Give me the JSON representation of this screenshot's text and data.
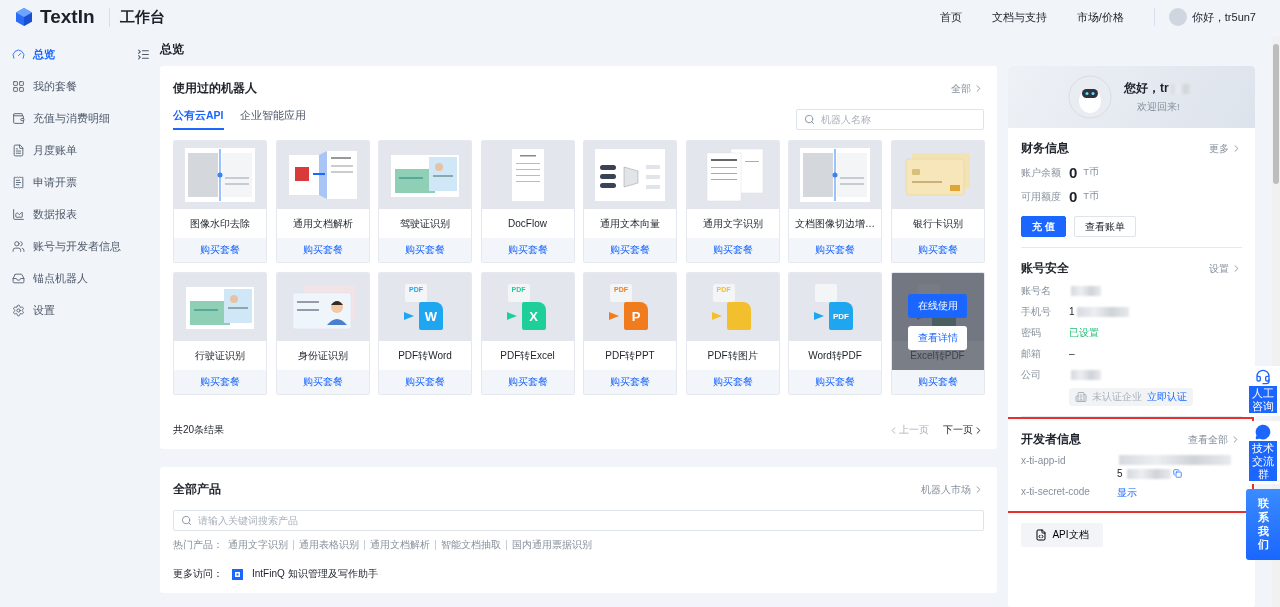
{
  "header": {
    "brand": "TextIn",
    "product": "工作台",
    "nav": [
      "首页",
      "文档与支持",
      "市场/价格"
    ],
    "user": "你好，tr5un7"
  },
  "sidebar": {
    "items": [
      {
        "label": "总览",
        "selected": true
      },
      {
        "label": "我的套餐",
        "selected": false
      },
      {
        "label": "充值与消费明细",
        "selected": false
      },
      {
        "label": "月度账单",
        "selected": false
      },
      {
        "label": "申请开票",
        "selected": false
      },
      {
        "label": "数据报表",
        "selected": false
      },
      {
        "label": "账号与开发者信息",
        "selected": false
      },
      {
        "label": "锚点机器人",
        "selected": false
      },
      {
        "label": "设置",
        "selected": false
      }
    ]
  },
  "page_title": "总览",
  "robots": {
    "title": "使用过的机器人",
    "all_link": "全部",
    "tabs": [
      {
        "label": "公有云API",
        "selected": true
      },
      {
        "label": "企业智能应用",
        "selected": false
      }
    ],
    "search": {
      "placeholder": "机器人名称"
    },
    "items": [
      {
        "name": "图像水印去除",
        "action": "购买套餐",
        "kind": "compare",
        "hovered": false
      },
      {
        "name": "通用文档解析",
        "action": "购买套餐",
        "kind": "pdfdoc",
        "hovered": false
      },
      {
        "name": "驾驶证识别",
        "action": "购买套餐",
        "kind": "license",
        "hovered": false
      },
      {
        "name": "DocFlow",
        "action": "购买套餐",
        "kind": "page",
        "hovered": false
      },
      {
        "name": "通用文本向量",
        "action": "购买套餐",
        "kind": "flow",
        "hovered": false
      },
      {
        "name": "通用文字识别",
        "action": "购买套餐",
        "kind": "pages",
        "hovered": false
      },
      {
        "name": "文档图像切边增…",
        "action": "购买套餐",
        "kind": "compare",
        "hovered": false
      },
      {
        "name": "银行卡识别",
        "action": "购买套餐",
        "kind": "bankcard",
        "hovered": false
      },
      {
        "name": "行驶证识别",
        "action": "购买套餐",
        "kind": "license",
        "hovered": false
      },
      {
        "name": "身份证识别",
        "action": "购买套餐",
        "kind": "idcard",
        "hovered": false
      },
      {
        "name": "PDF转Word",
        "action": "购买套餐",
        "kind": "convert",
        "tag": "PDF",
        "glyph": "W",
        "color": "#1ea7f0",
        "hovered": false
      },
      {
        "name": "PDF转Excel",
        "action": "购买套餐",
        "kind": "convert",
        "tag": "PDF",
        "glyph": "X",
        "color": "#1fcf9a",
        "hovered": false
      },
      {
        "name": "PDF转PPT",
        "action": "购买套餐",
        "kind": "convert",
        "tag": "PDF",
        "glyph": "P",
        "color": "#f07c1e",
        "hovered": false
      },
      {
        "name": "PDF转图片",
        "action": "购买套餐",
        "kind": "convert",
        "tag": "PDF",
        "color": "#f2c02c",
        "hovered": false
      },
      {
        "name": "Word转PDF",
        "action": "购买套餐",
        "kind": "convert",
        "glyph": "PDF",
        "color": "#1ea7f0",
        "hovered": false
      },
      {
        "name": "Excel转PDF",
        "action": "购买套餐",
        "kind": "convert",
        "hovered": true
      }
    ],
    "hover_actions": [
      "在线使用",
      "查看详情"
    ],
    "total": "共20条结果",
    "prev": "上一页",
    "next": "下一页"
  },
  "products": {
    "title": "全部产品",
    "market_link": "机器人市场",
    "search": {
      "placeholder": "请输入关键词搜索产品"
    },
    "hot_label": "热门产品：",
    "hot": [
      "通用文字识别",
      "通用表格识别",
      "通用文档解析",
      "智能文档抽取",
      "国内通用票据识别"
    ],
    "more_label": "更多访问：",
    "more_link": "IntFinQ 知识管理及写作助手"
  },
  "profile": {
    "greeting": "您好，tr",
    "welcome": "欢迎回来!"
  },
  "finance": {
    "title": "财务信息",
    "link": "更多",
    "rows": [
      {
        "label": "账户余额",
        "value": "0",
        "unit": "T币"
      },
      {
        "label": "可用额度",
        "value": "0",
        "unit": "T币"
      }
    ],
    "buttons": [
      {
        "label": "充 值",
        "kind": "primary"
      },
      {
        "label": "查看账单",
        "kind": "default"
      }
    ]
  },
  "security": {
    "title": "账号安全",
    "link": "设置",
    "rows": [
      {
        "label": "账号名",
        "masked": true
      },
      {
        "label": "手机号",
        "value": "1",
        "masked": true
      },
      {
        "label": "密码",
        "value": "已设置",
        "kind": "ok",
        "masked": false
      },
      {
        "label": "邮箱",
        "value": "–",
        "masked": false
      },
      {
        "label": "公司",
        "masked": true
      }
    ],
    "company_badge": {
      "status": "未认证企业",
      "action": "立即认证"
    }
  },
  "developer": {
    "title": "开发者信息",
    "link": "查看全部",
    "highlighted": true,
    "rows": [
      {
        "label": "x-ti-app-id",
        "value": "5",
        "masked": true,
        "copy": true
      },
      {
        "label": "x-ti-secret-code",
        "action": "显示",
        "masked": false,
        "copy": false
      }
    ]
  },
  "api_doc": "API文档",
  "float": {
    "buttons": [
      "人工咨询",
      "技术交流群"
    ],
    "contact": "联系我们"
  }
}
